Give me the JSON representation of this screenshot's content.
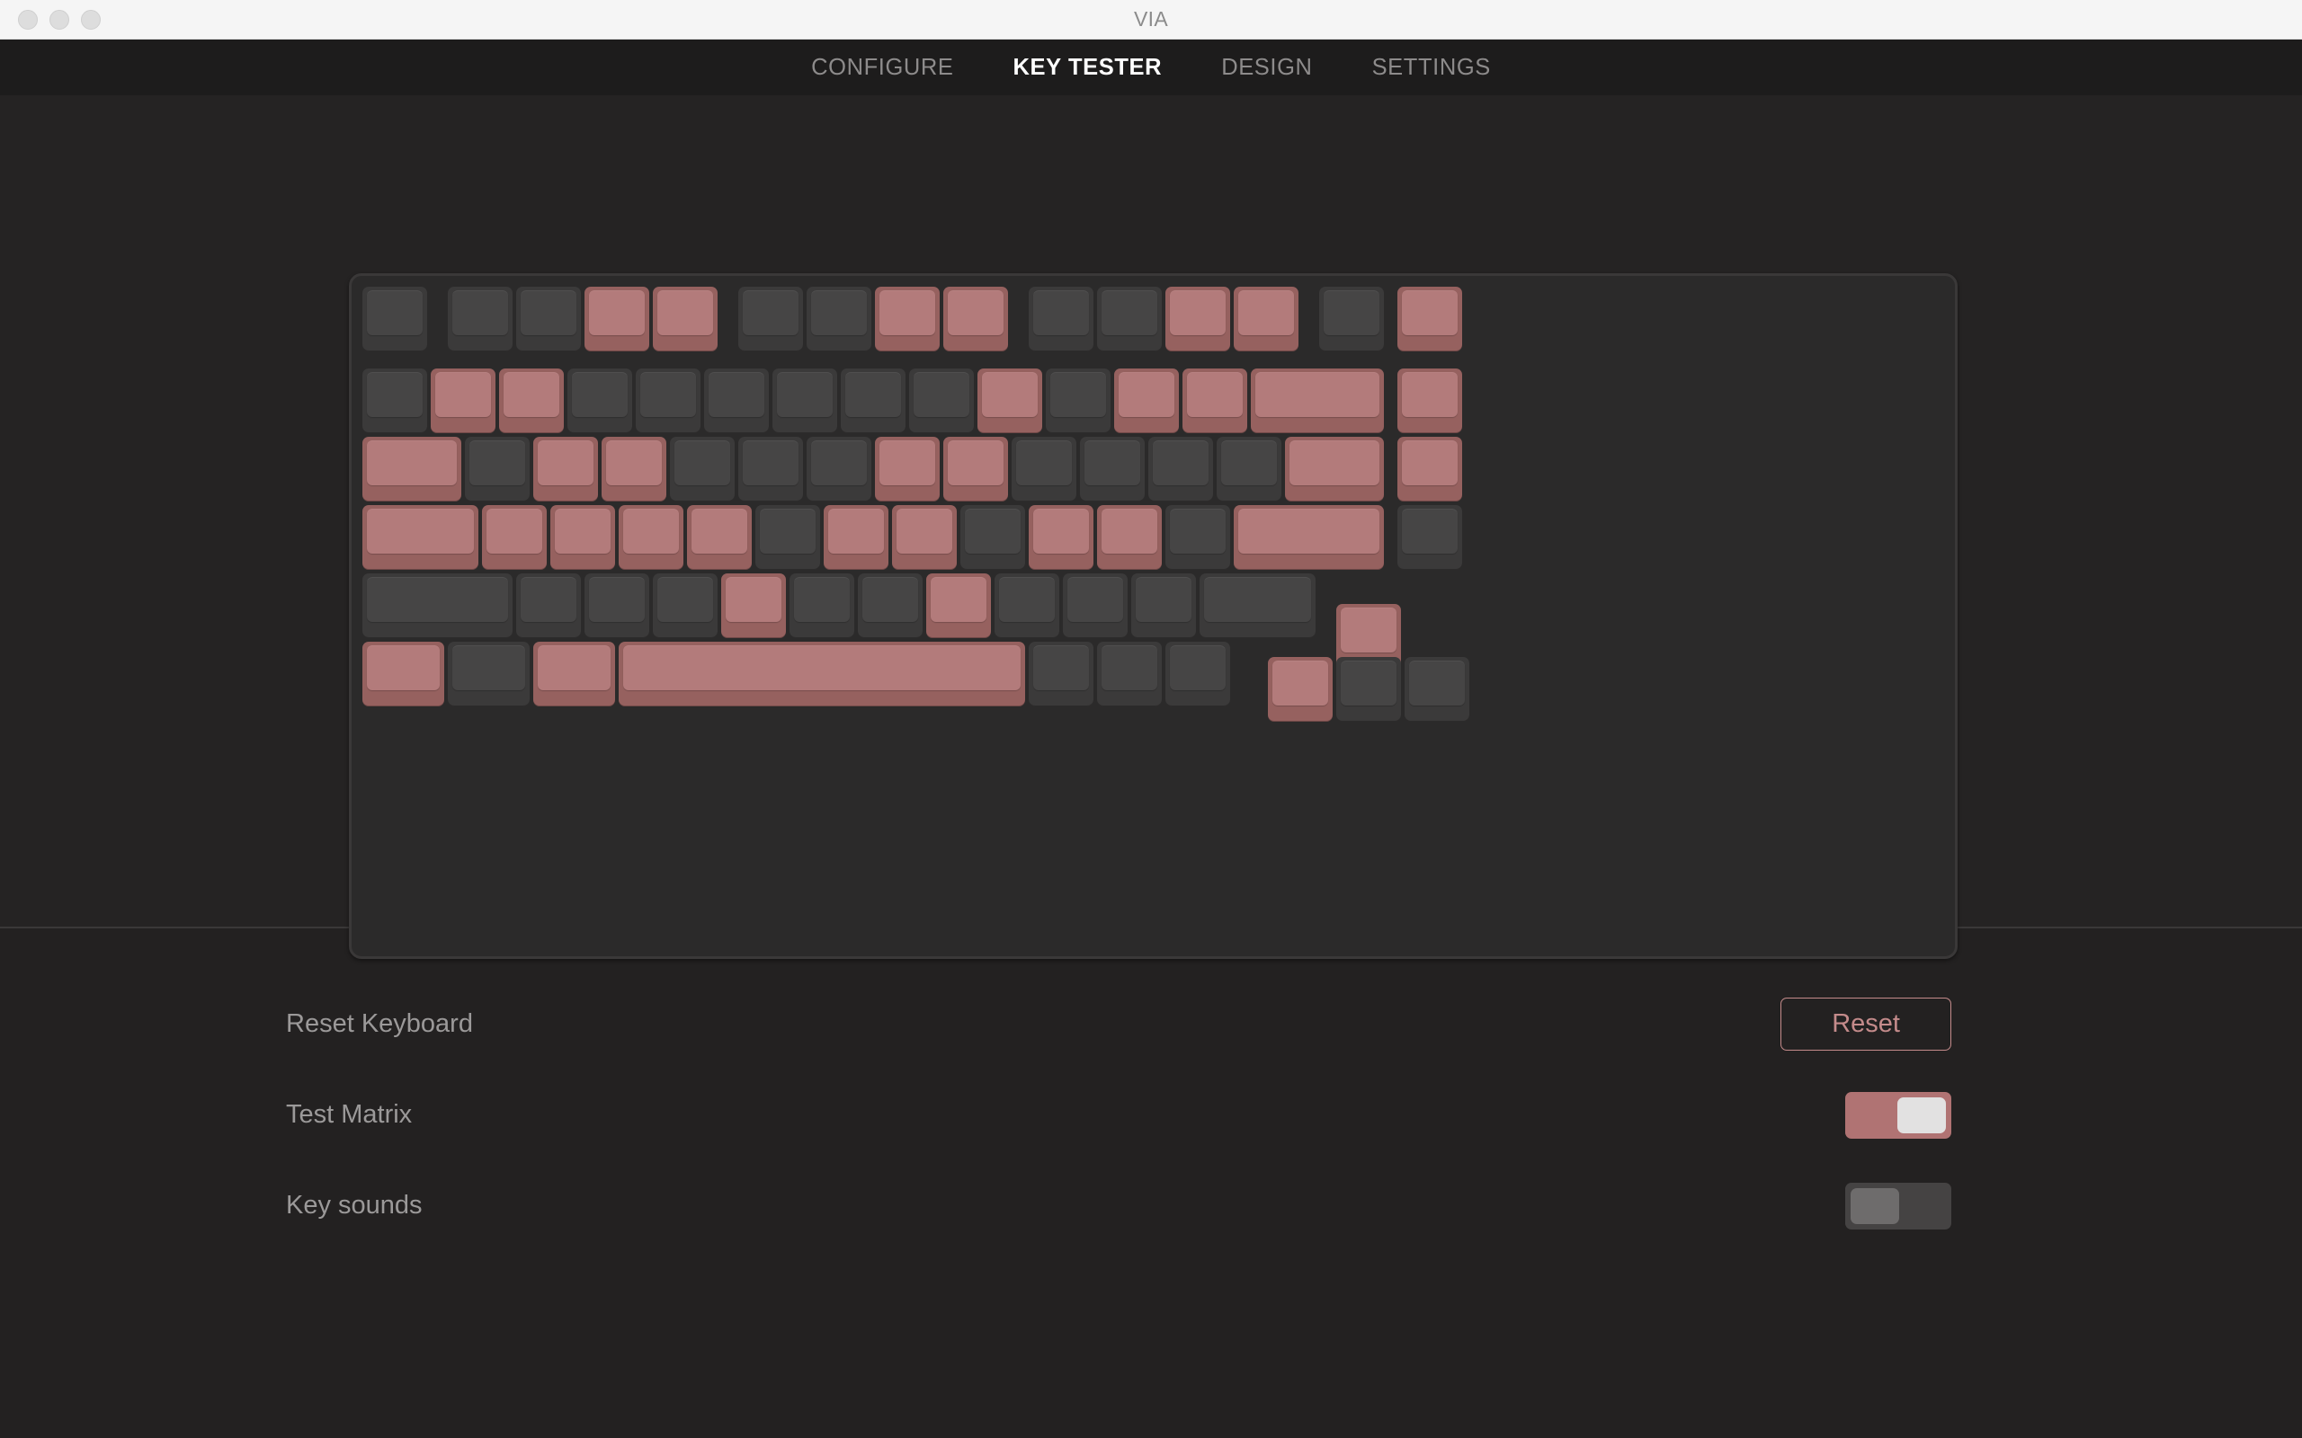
{
  "window": {
    "title": "VIA",
    "traffic_lights": [
      "close-button",
      "minimize-button",
      "zoom-button"
    ]
  },
  "nav": {
    "tabs": [
      {
        "label": "CONFIGURE",
        "active": false
      },
      {
        "label": "KEY TESTER",
        "active": true
      },
      {
        "label": "DESIGN",
        "active": false
      },
      {
        "label": "SETTINGS",
        "active": false
      }
    ]
  },
  "colors": {
    "key_pressed_cap": "#b37b7b",
    "key_pressed_body": "#96615f",
    "key_idle_cap": "#464545",
    "key_idle_body": "#3b3a3a",
    "accent": "#c48b8b",
    "toggle_on": "#b07373",
    "toggle_off": "#454343",
    "case": "#2b2a2a",
    "background": "#252323",
    "titlebar": "#f5f5f5"
  },
  "keyboard": {
    "unit": 76,
    "rows": [
      {
        "y": 0,
        "keys": [
          {
            "x": 0,
            "w": 1,
            "name": "key-esc",
            "pressed": false
          },
          {
            "x": 1.25,
            "w": 1,
            "name": "key-f1",
            "pressed": false
          },
          {
            "x": 2.25,
            "w": 1,
            "name": "key-f2",
            "pressed": false
          },
          {
            "x": 3.25,
            "w": 1,
            "name": "key-f3",
            "pressed": true
          },
          {
            "x": 4.25,
            "w": 1,
            "name": "key-f4",
            "pressed": true
          },
          {
            "x": 5.5,
            "w": 1,
            "name": "key-f5",
            "pressed": false
          },
          {
            "x": 6.5,
            "w": 1,
            "name": "key-f6",
            "pressed": false
          },
          {
            "x": 7.5,
            "w": 1,
            "name": "key-f7",
            "pressed": true
          },
          {
            "x": 8.5,
            "w": 1,
            "name": "key-f8",
            "pressed": true
          },
          {
            "x": 9.75,
            "w": 1,
            "name": "key-f9",
            "pressed": false
          },
          {
            "x": 10.75,
            "w": 1,
            "name": "key-f10",
            "pressed": false
          },
          {
            "x": 11.75,
            "w": 1,
            "name": "key-f11",
            "pressed": true
          },
          {
            "x": 12.75,
            "w": 1,
            "name": "key-f12",
            "pressed": true
          },
          {
            "x": 14,
            "w": 1,
            "name": "key-delete",
            "pressed": false
          },
          {
            "x": 15.15,
            "w": 1,
            "name": "key-home",
            "pressed": true
          }
        ]
      },
      {
        "y": 1.2,
        "keys": [
          {
            "x": 0,
            "w": 1,
            "name": "key-grave",
            "pressed": false
          },
          {
            "x": 1,
            "w": 1,
            "name": "key-1",
            "pressed": true
          },
          {
            "x": 2,
            "w": 1,
            "name": "key-2",
            "pressed": true
          },
          {
            "x": 3,
            "w": 1,
            "name": "key-3",
            "pressed": false
          },
          {
            "x": 4,
            "w": 1,
            "name": "key-4",
            "pressed": false
          },
          {
            "x": 5,
            "w": 1,
            "name": "key-5",
            "pressed": false
          },
          {
            "x": 6,
            "w": 1,
            "name": "key-6",
            "pressed": false
          },
          {
            "x": 7,
            "w": 1,
            "name": "key-7",
            "pressed": false
          },
          {
            "x": 8,
            "w": 1,
            "name": "key-8",
            "pressed": false
          },
          {
            "x": 9,
            "w": 1,
            "name": "key-9",
            "pressed": true
          },
          {
            "x": 10,
            "w": 1,
            "name": "key-0",
            "pressed": false
          },
          {
            "x": 11,
            "w": 1,
            "name": "key-minus",
            "pressed": true
          },
          {
            "x": 12,
            "w": 1,
            "name": "key-equal",
            "pressed": true
          },
          {
            "x": 13,
            "w": 2,
            "name": "key-backspace",
            "pressed": true
          },
          {
            "x": 15.15,
            "w": 1,
            "name": "key-pageup",
            "pressed": true
          }
        ]
      },
      {
        "y": 2.2,
        "keys": [
          {
            "x": 0,
            "w": 1.5,
            "name": "key-tab",
            "pressed": true
          },
          {
            "x": 1.5,
            "w": 1,
            "name": "key-q",
            "pressed": false
          },
          {
            "x": 2.5,
            "w": 1,
            "name": "key-w",
            "pressed": true
          },
          {
            "x": 3.5,
            "w": 1,
            "name": "key-e",
            "pressed": true
          },
          {
            "x": 4.5,
            "w": 1,
            "name": "key-r",
            "pressed": false
          },
          {
            "x": 5.5,
            "w": 1,
            "name": "key-t",
            "pressed": false
          },
          {
            "x": 6.5,
            "w": 1,
            "name": "key-y",
            "pressed": false
          },
          {
            "x": 7.5,
            "w": 1,
            "name": "key-u",
            "pressed": true
          },
          {
            "x": 8.5,
            "w": 1,
            "name": "key-i",
            "pressed": true
          },
          {
            "x": 9.5,
            "w": 1,
            "name": "key-o",
            "pressed": false
          },
          {
            "x": 10.5,
            "w": 1,
            "name": "key-p",
            "pressed": false
          },
          {
            "x": 11.5,
            "w": 1,
            "name": "key-bracket-left",
            "pressed": false
          },
          {
            "x": 12.5,
            "w": 1,
            "name": "key-bracket-right",
            "pressed": false
          },
          {
            "x": 13.5,
            "w": 1.5,
            "name": "key-backslash",
            "pressed": true
          },
          {
            "x": 15.15,
            "w": 1,
            "name": "key-pagedown",
            "pressed": true
          }
        ]
      },
      {
        "y": 3.2,
        "keys": [
          {
            "x": 0,
            "w": 1.75,
            "name": "key-capslock",
            "pressed": true
          },
          {
            "x": 1.75,
            "w": 1,
            "name": "key-a",
            "pressed": true
          },
          {
            "x": 2.75,
            "w": 1,
            "name": "key-s",
            "pressed": true
          },
          {
            "x": 3.75,
            "w": 1,
            "name": "key-d",
            "pressed": true
          },
          {
            "x": 4.75,
            "w": 1,
            "name": "key-f",
            "pressed": true
          },
          {
            "x": 5.75,
            "w": 1,
            "name": "key-g",
            "pressed": false
          },
          {
            "x": 6.75,
            "w": 1,
            "name": "key-h",
            "pressed": true
          },
          {
            "x": 7.75,
            "w": 1,
            "name": "key-j",
            "pressed": true
          },
          {
            "x": 8.75,
            "w": 1,
            "name": "key-k",
            "pressed": false
          },
          {
            "x": 9.75,
            "w": 1,
            "name": "key-l",
            "pressed": true
          },
          {
            "x": 10.75,
            "w": 1,
            "name": "key-semicolon",
            "pressed": true
          },
          {
            "x": 11.75,
            "w": 1,
            "name": "key-quote",
            "pressed": false
          },
          {
            "x": 12.75,
            "w": 2.25,
            "name": "key-enter",
            "pressed": true
          },
          {
            "x": 15.15,
            "w": 1,
            "name": "key-end",
            "pressed": false
          }
        ]
      },
      {
        "y": 4.2,
        "keys": [
          {
            "x": 0,
            "w": 2.25,
            "name": "key-shift-left",
            "pressed": false
          },
          {
            "x": 2.25,
            "w": 1,
            "name": "key-z",
            "pressed": false
          },
          {
            "x": 3.25,
            "w": 1,
            "name": "key-x",
            "pressed": false
          },
          {
            "x": 4.25,
            "w": 1,
            "name": "key-c",
            "pressed": false
          },
          {
            "x": 5.25,
            "w": 1,
            "name": "key-v",
            "pressed": true
          },
          {
            "x": 6.25,
            "w": 1,
            "name": "key-b",
            "pressed": false
          },
          {
            "x": 7.25,
            "w": 1,
            "name": "key-n",
            "pressed": false
          },
          {
            "x": 8.25,
            "w": 1,
            "name": "key-m",
            "pressed": true
          },
          {
            "x": 9.25,
            "w": 1,
            "name": "key-comma",
            "pressed": false
          },
          {
            "x": 10.25,
            "w": 1,
            "name": "key-period",
            "pressed": false
          },
          {
            "x": 11.25,
            "w": 1,
            "name": "key-slash",
            "pressed": false
          },
          {
            "x": 12.25,
            "w": 1.75,
            "name": "key-shift-right",
            "pressed": false
          },
          {
            "x": 14.25,
            "w": 1,
            "name": "key-arrow-up",
            "pressed": true,
            "yoffset": 0.45
          }
        ]
      },
      {
        "y": 5.2,
        "keys": [
          {
            "x": 0,
            "w": 1.25,
            "name": "key-control",
            "pressed": true
          },
          {
            "x": 1.25,
            "w": 1.25,
            "name": "key-option-left",
            "pressed": false
          },
          {
            "x": 2.5,
            "w": 1.25,
            "name": "key-command-left",
            "pressed": true
          },
          {
            "x": 3.75,
            "w": 6,
            "name": "key-space",
            "pressed": true
          },
          {
            "x": 9.75,
            "w": 1,
            "name": "key-command-right",
            "pressed": false
          },
          {
            "x": 10.75,
            "w": 1,
            "name": "key-option-right",
            "pressed": false
          },
          {
            "x": 11.75,
            "w": 1,
            "name": "key-fn",
            "pressed": false
          },
          {
            "x": 13.25,
            "w": 1,
            "name": "key-arrow-left",
            "pressed": true,
            "yoffset": 0.22
          },
          {
            "x": 14.25,
            "w": 1,
            "name": "key-arrow-down",
            "pressed": false,
            "yoffset": 0.22
          },
          {
            "x": 15.25,
            "w": 1,
            "name": "key-arrow-right",
            "pressed": false,
            "yoffset": 0.22
          }
        ]
      }
    ]
  },
  "settings": {
    "rows": [
      {
        "label": "Reset Keyboard",
        "control": "button",
        "button_label": "Reset",
        "name": "reset-keyboard"
      },
      {
        "label": "Test Matrix",
        "control": "toggle",
        "value": true,
        "name": "test-matrix"
      },
      {
        "label": "Key sounds",
        "control": "toggle",
        "value": false,
        "name": "key-sounds"
      }
    ]
  }
}
